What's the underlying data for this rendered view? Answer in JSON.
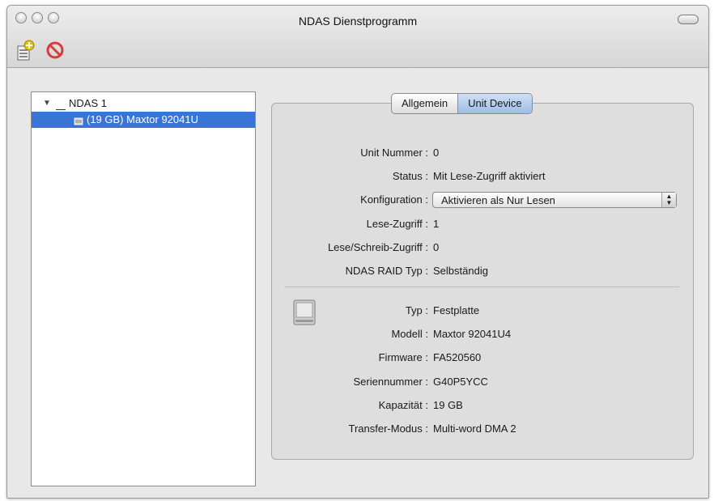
{
  "window": {
    "title": "NDAS Dienstprogramm"
  },
  "toolbar": {
    "add_icon": "add-device-icon",
    "remove_icon": "no-entry-icon"
  },
  "tree": {
    "items": [
      {
        "label": "NDAS 1",
        "expanded": true
      },
      {
        "label": "(19 GB) Maxtor 92041U",
        "selected": true
      }
    ]
  },
  "tabs": [
    {
      "label": "Allgemein",
      "active": false
    },
    {
      "label": "Unit Device",
      "active": true
    }
  ],
  "unit": {
    "unit_nummer_label": "Unit Nummer :",
    "unit_nummer_value": "0",
    "status_label": "Status :",
    "status_value": "Mit Lese-Zugriff aktiviert",
    "konfiguration_label": "Konfiguration :",
    "konfiguration_value": "Aktivieren als Nur Lesen",
    "lese_label": "Lese-Zugriff :",
    "lese_value": "1",
    "lese_schreib_label": "Lese/Schreib-Zugriff :",
    "lese_schreib_value": "0",
    "raid_label": "NDAS RAID Typ :",
    "raid_value": "Selbständig"
  },
  "device": {
    "typ_label": "Typ :",
    "typ_value": "Festplatte",
    "modell_label": "Modell :",
    "modell_value": "Maxtor 92041U4",
    "firmware_label": "Firmware :",
    "firmware_value": "FA520560",
    "serien_label": "Seriennummer :",
    "serien_value": "G40P5YCC",
    "kapazitaet_label": "Kapazität :",
    "kapazitaet_value": "19 GB",
    "transfer_label": "Transfer-Modus :",
    "transfer_value": "Multi-word DMA 2"
  },
  "colors": {
    "selection": "#3875d7",
    "active_tab": "#9dbde4"
  }
}
